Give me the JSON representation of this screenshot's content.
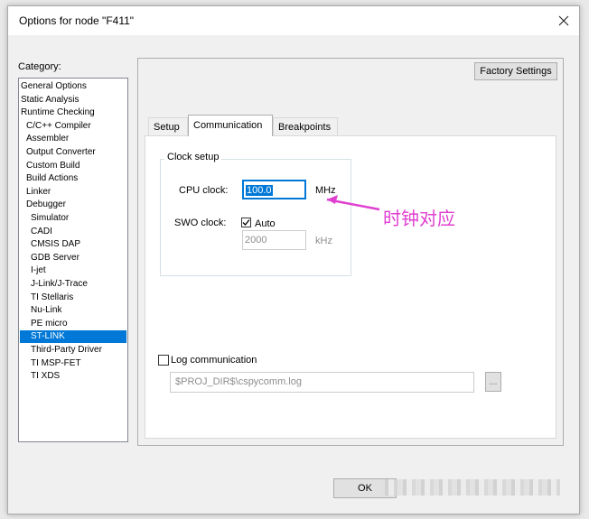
{
  "window": {
    "title": "Options for node \"F411\""
  },
  "category": {
    "label": "Category:",
    "items": [
      {
        "label": "General Options",
        "indent": 0
      },
      {
        "label": "Static Analysis",
        "indent": 0
      },
      {
        "label": "Runtime Checking",
        "indent": 0
      },
      {
        "label": "C/C++ Compiler",
        "indent": 1
      },
      {
        "label": "Assembler",
        "indent": 1
      },
      {
        "label": "Output Converter",
        "indent": 1
      },
      {
        "label": "Custom Build",
        "indent": 1
      },
      {
        "label": "Build Actions",
        "indent": 1
      },
      {
        "label": "Linker",
        "indent": 1
      },
      {
        "label": "Debugger",
        "indent": 1
      },
      {
        "label": "Simulator",
        "indent": 2
      },
      {
        "label": "CADI",
        "indent": 2
      },
      {
        "label": "CMSIS DAP",
        "indent": 2
      },
      {
        "label": "GDB Server",
        "indent": 2
      },
      {
        "label": "I-jet",
        "indent": 2
      },
      {
        "label": "J-Link/J-Trace",
        "indent": 2
      },
      {
        "label": "TI Stellaris",
        "indent": 2
      },
      {
        "label": "Nu-Link",
        "indent": 2
      },
      {
        "label": "PE micro",
        "indent": 2
      },
      {
        "label": "ST-LINK",
        "indent": 2,
        "selected": true
      },
      {
        "label": "Third-Party Driver",
        "indent": 2
      },
      {
        "label": "TI MSP-FET",
        "indent": 2
      },
      {
        "label": "TI XDS",
        "indent": 2
      }
    ]
  },
  "factory_settings_label": "Factory Settings",
  "tabs": [
    {
      "label": "Setup",
      "active": false
    },
    {
      "label": "Communication",
      "active": true
    },
    {
      "label": "Breakpoints",
      "active": false
    }
  ],
  "clock_setup": {
    "group_label": "Clock setup",
    "cpu_label": "CPU clock:",
    "cpu_value": "100.0",
    "cpu_unit": "MHz",
    "swo_label": "SWO clock:",
    "auto_label": "Auto",
    "auto_checked": true,
    "swo_value": "2000",
    "swo_unit": "kHz"
  },
  "log": {
    "label": "Log communication",
    "checked": false,
    "path": "$PROJ_DIR$\\cspycomm.log",
    "browse_label": "..."
  },
  "annotation": {
    "text": "时钟对应",
    "color": "#e040d0"
  },
  "ok_label": "OK",
  "colors": {
    "selection": "#0078d7",
    "annotation": "#e040d0"
  }
}
